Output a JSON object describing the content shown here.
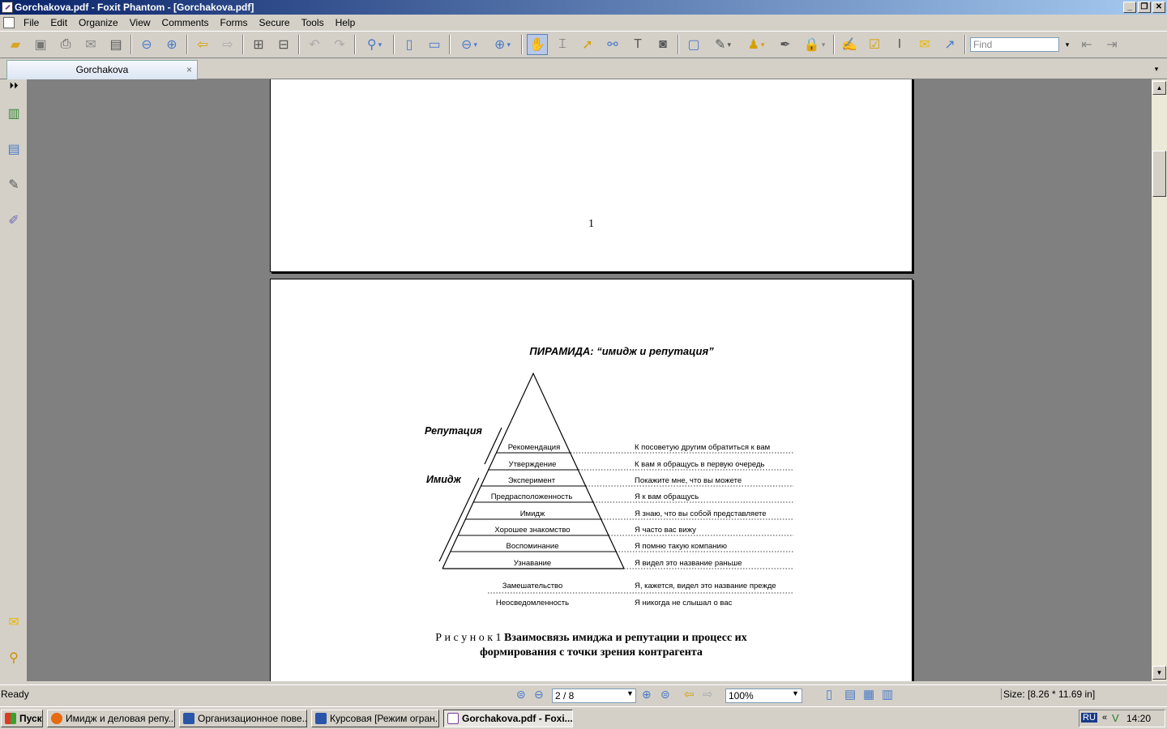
{
  "window": {
    "title": "Gorchakova.pdf - Foxit Phantom - [Gorchakova.pdf]"
  },
  "menu": [
    "File",
    "Edit",
    "Organize",
    "View",
    "Comments",
    "Forms",
    "Secure",
    "Tools",
    "Help"
  ],
  "toolbar": {
    "find_placeholder": "Find"
  },
  "tab": {
    "label": "Gorchakova",
    "close": "×"
  },
  "page1": {
    "page_number": "1"
  },
  "figure": {
    "heading": "ПИРАМИДА: “имидж и репутация”",
    "label_reputation": "Репутация",
    "label_image": "Имидж",
    "levels": [
      {
        "stage": "Рекомендация",
        "phrase": "К посоветую другим обратиться к вам"
      },
      {
        "stage": "Утверждение",
        "phrase": "К вам я обращусь в первую очередь"
      },
      {
        "stage": "Эксперимент",
        "phrase": "Покажите мне, что вы можете"
      },
      {
        "stage": "Предрасположенность",
        "phrase": "Я к вам обращусь"
      },
      {
        "stage": "Имидж",
        "phrase": "Я знаю, что вы собой представляете"
      },
      {
        "stage": "Хорошее знакомство",
        "phrase": "Я часто вас вижу"
      },
      {
        "stage": "Воспоминание",
        "phrase": "Я помню такую компанию"
      },
      {
        "stage": "Узнавание",
        "phrase": "Я видел это название раньше"
      }
    ],
    "below": [
      {
        "stage": "Замешательство",
        "phrase": "Я, кажется, видел это название прежде"
      },
      {
        "stage": "Неосведомленность",
        "phrase": "Я никогда не слышал о вас"
      }
    ],
    "caption_prefix": "Р и с у н о к 1",
    "caption_bold_1": "Взаимосвязь имиджа и репутации и  процесс их",
    "caption_bold_2": "формирования с точки зрения контрагента"
  },
  "status": {
    "ready": "Ready",
    "page_field": "2 / 8",
    "zoom": "100%",
    "size": "Size: [8.26 * 11.69 in]"
  },
  "taskbar": {
    "start": "Пуск",
    "items": [
      "Имидж и деловая репу...",
      "Организационное пове...",
      "Курсовая [Режим огран...",
      "Gorchakova.pdf - Foxi..."
    ],
    "lang": "RU",
    "clock": "14:20"
  }
}
